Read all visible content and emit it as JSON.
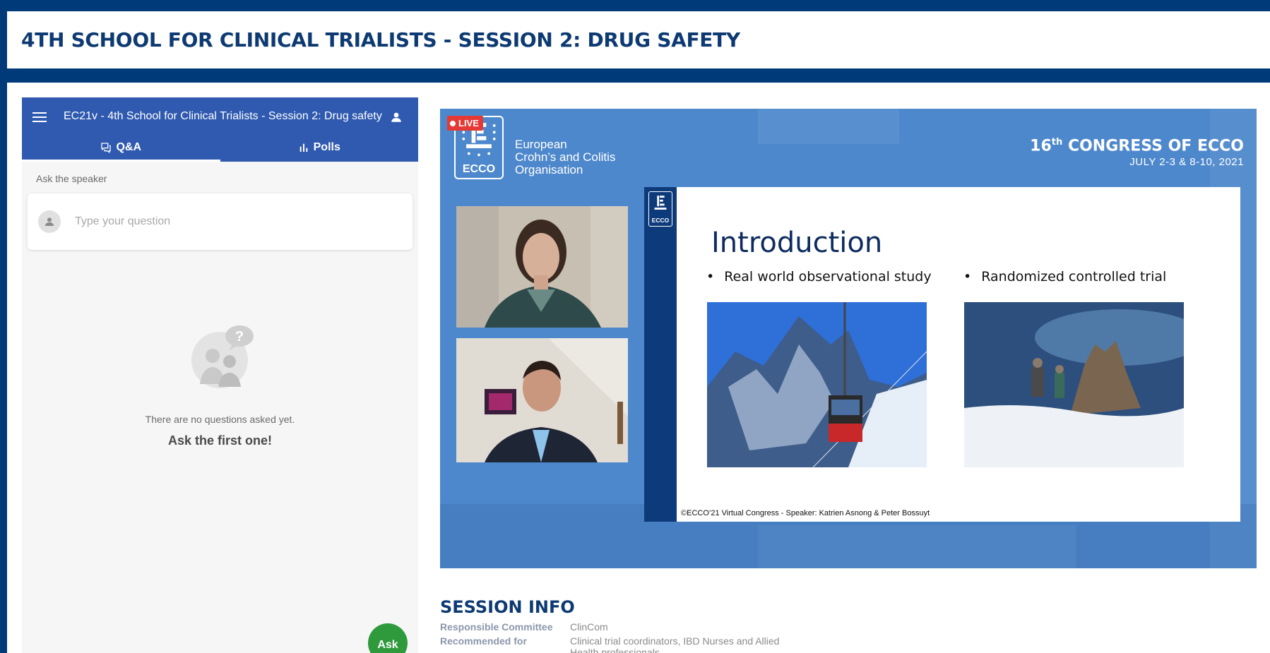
{
  "page_title": "4TH SCHOOL FOR CLINICAL TRIALISTS - SESSION 2: DRUG SAFETY",
  "qa": {
    "header_title": "EC21v - 4th School for Clinical Trialists - Session 2: Drug safety",
    "tabs": [
      {
        "label": "Q&A",
        "active": true
      },
      {
        "label": "Polls",
        "active": false
      }
    ],
    "ask_label": "Ask the speaker",
    "input_placeholder": "Type your question",
    "empty_text": "There are no questions asked yet.",
    "empty_cta": "Ask the first one!",
    "ask_button": "Ask"
  },
  "video": {
    "live_label": "LIVE",
    "logo_text": "ECCO",
    "org_lines": [
      "European",
      "Crohn’s and Colitis",
      "Organisation"
    ],
    "congress_num": "16",
    "congress_sup": "th",
    "congress_text": "CONGRESS OF ECCO",
    "congress_dates": "JULY 2-3 & 8-10, 2021",
    "slide": {
      "title": "Introduction",
      "bullets": [
        "Real world observational study",
        "Randomized controlled trial"
      ],
      "footer": "©ECCO’21 Virtual Congress -  Speaker: Katrien Asnong & Peter Bossuyt",
      "mini_logo_text": "ECCO"
    }
  },
  "session_info": {
    "title": "SESSION INFO",
    "rows": [
      {
        "key": "Responsible Committee",
        "value": "ClinCom"
      },
      {
        "key": "Recommended for",
        "value": "Clinical trial coordinators, IBD Nurses and Allied Health professionals"
      }
    ]
  },
  "colors": {
    "brand_blue": "#003a78",
    "header_blue": "#2f5ab0",
    "ask_green": "#2e9a3b",
    "live_red": "#e53935"
  }
}
